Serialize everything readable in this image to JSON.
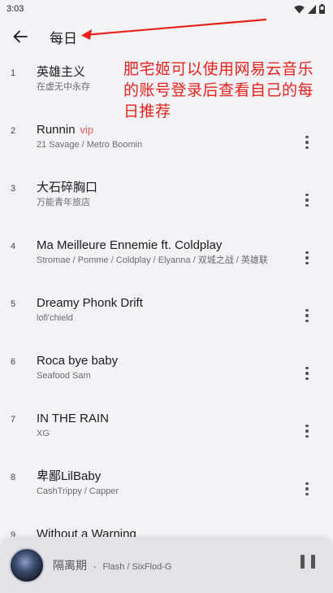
{
  "status_bar": {
    "time": "3:03"
  },
  "header": {
    "title": "每日"
  },
  "annotation": {
    "text": "肥宅姬可以使用网易云音乐的账号登录后查看自己的每日推荐"
  },
  "tracks": [
    {
      "index": "1",
      "title": "英雄主义",
      "artist": "在虚无中永存",
      "vip": "",
      "has_more": false
    },
    {
      "index": "2",
      "title": "Runnin",
      "artist": "21 Savage / Metro Boomin",
      "vip": "vip",
      "has_more": true
    },
    {
      "index": "3",
      "title": "大石碎胸口",
      "artist": "万能青年旅店",
      "vip": "",
      "has_more": true
    },
    {
      "index": "4",
      "title": "Ma Meilleure Ennemie ft. Coldplay",
      "artist": "Stromae / Pomme / Coldplay / Elyanna / 双城之战 / 英雄联",
      "vip": "",
      "has_more": true
    },
    {
      "index": "5",
      "title": "Dreamy Phonk Drift",
      "artist": "lofi'chield",
      "vip": "",
      "has_more": true
    },
    {
      "index": "6",
      "title": "Roca bye baby",
      "artist": "Seafood Sam",
      "vip": "",
      "has_more": true
    },
    {
      "index": "7",
      "title": "IN THE RAIN",
      "artist": "XG",
      "vip": "",
      "has_more": true
    },
    {
      "index": "8",
      "title": "卑鄙LilBaby",
      "artist": "CashTrippy / Capper",
      "vip": "",
      "has_more": true
    },
    {
      "index": "9",
      "title": "Without a Warning",
      "artist": "",
      "vip": "",
      "has_more": true
    }
  ],
  "player": {
    "title": "隔离期",
    "separator": "-",
    "artist": "Flash / SixFlod-G"
  },
  "colors": {
    "accent": "#e35c58",
    "annotation": "#e8221b",
    "background": "#f3f2f6"
  }
}
